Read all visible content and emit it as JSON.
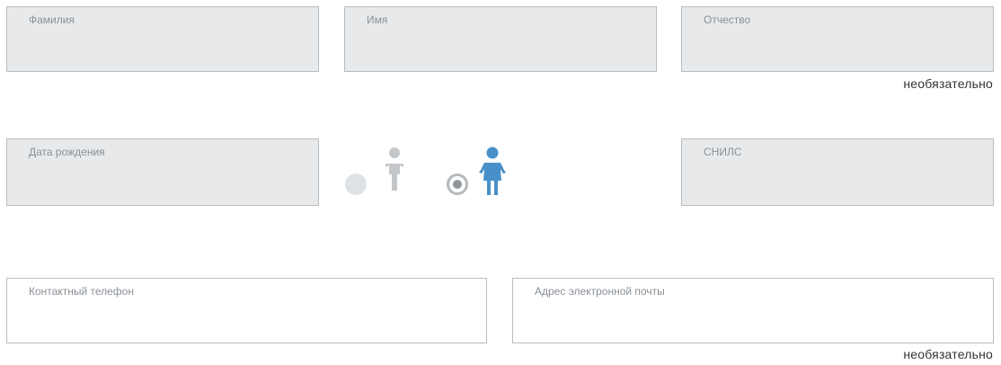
{
  "form": {
    "last_name": {
      "label": "Фамилия",
      "value": ""
    },
    "first_name": {
      "label": "Имя",
      "value": ""
    },
    "middle_name": {
      "label": "Отчество",
      "value": "",
      "hint": "необязательно"
    },
    "birth_date": {
      "label": "Дата рождения",
      "value": ""
    },
    "snils": {
      "label": "СНИЛС",
      "value": ""
    },
    "phone": {
      "label": "Контактный телефон",
      "value": ""
    },
    "email": {
      "label": "Адрес электронной почты",
      "value": "",
      "hint": "необязательно"
    }
  },
  "gender": {
    "options": [
      {
        "icon": "male-icon",
        "selected": false
      },
      {
        "icon": "female-icon",
        "selected": true
      }
    ]
  },
  "colors": {
    "field_fill": "#e7e9eb",
    "field_border": "#b7bcc1",
    "label_text": "#8a9096",
    "selected_icon": "#4a90c8",
    "unselected_icon": "#c4c7ca"
  }
}
